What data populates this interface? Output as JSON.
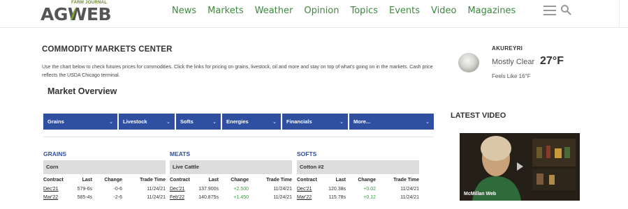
{
  "header": {
    "logo_small": "FARM JOURNAL",
    "logo_main": "AGWEB",
    "nav": [
      "News",
      "Markets",
      "Weather",
      "Opinion",
      "Topics",
      "Events",
      "Video",
      "Magazines"
    ],
    "icons": [
      "menu-icon",
      "search-icon"
    ],
    "brand_color": "#3d8a3d"
  },
  "main": {
    "title": "COMMODITY MARKETS CENTER",
    "intro": "Use the chart below to check futures prices for commodities. Click the links for pricing on grains, livestock, oil and more and stay on top of what's going on in the markets. Cash price reflects the USDA Chicago terminal.",
    "overview_title": "Market Overview",
    "tab_color": "#2f4fa0",
    "tabs": [
      {
        "label": "Grains"
      },
      {
        "label": "Livestock"
      },
      {
        "label": "Softs"
      },
      {
        "label": "Energies"
      },
      {
        "label": "Financials"
      },
      {
        "label": "More..."
      }
    ],
    "columns": {
      "contract": "Contract",
      "last": "Last",
      "change": "Change",
      "time": "Trade Time"
    },
    "sections": [
      {
        "title": "GRAINS",
        "subhead": "Corn",
        "rows": [
          {
            "contract": "Dec'21",
            "last": "579-6s",
            "change": "-0-6",
            "time": "11/24/21"
          },
          {
            "contract": "Mar'22",
            "last": "585-4s",
            "change": "-2-6",
            "time": "11/24/21"
          }
        ]
      },
      {
        "title": "MEATS",
        "subhead": "Live Cattle",
        "rows": [
          {
            "contract": "Dec'21",
            "last": "137.900s",
            "change": "+2.500",
            "time": "11/24/21"
          },
          {
            "contract": "Feb'22",
            "last": "140.875s",
            "change": "+1.450",
            "time": "11/24/21"
          }
        ]
      },
      {
        "title": "SOFTS",
        "subhead": "Cotton #2",
        "rows": [
          {
            "contract": "Dec'21",
            "last": "120.38s",
            "change": "+0.02",
            "time": "11/24/21"
          },
          {
            "contract": "Mar'22",
            "last": "115.78s",
            "change": "+0.12",
            "time": "11/24/21"
          }
        ]
      }
    ],
    "positive_color": "#2aa23a"
  },
  "weather": {
    "city": "AKUREYRI",
    "condition": "Mostly Clear",
    "temp": "27°F",
    "feels_like": "Feels Like  16°F"
  },
  "video": {
    "heading": "LATEST VIDEO",
    "label": "McMillan Web"
  }
}
